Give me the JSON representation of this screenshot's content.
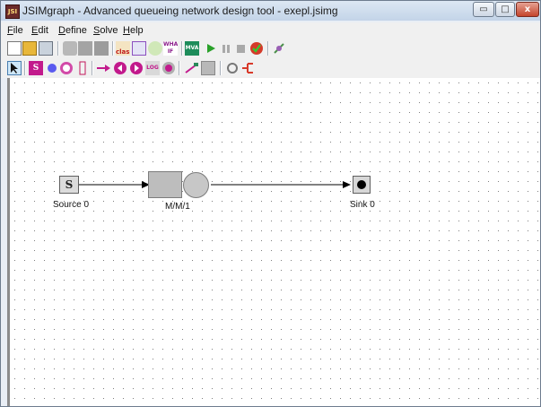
{
  "window": {
    "title": "JSIMgraph - Advanced queueing network design tool - exepl.jsimg",
    "controls": {
      "minimize": "▭",
      "maximize": "□",
      "close": "x"
    }
  },
  "menu": [
    {
      "mnemonic": "F",
      "rest": "ile"
    },
    {
      "mnemonic": "E",
      "rest": "dit"
    },
    {
      "mnemonic": "D",
      "rest": "efine"
    },
    {
      "mnemonic": "S",
      "rest": "olve"
    },
    {
      "mnemonic": "H",
      "rest": "elp"
    }
  ],
  "toolbar_main": {
    "icons": [
      "new-file-icon",
      "open-folder-icon",
      "save-icon",
      "cut-icon",
      "copy-icon",
      "paste-icon",
      "classes-icon",
      "parameters-icon",
      "measures-icon",
      "what-if-icon",
      "mva-icon",
      "run-icon",
      "pause-icon",
      "stop-icon",
      "results-icon",
      "options-icon"
    ],
    "labels": {
      "classes": "class",
      "what_if": "WHAT IF",
      "mva": "MVA"
    }
  },
  "toolbar_components": {
    "icons": [
      "select-arrow-icon",
      "source-icon",
      "sink-icon",
      "queue-station-icon",
      "delay-icon",
      "fork-icon",
      "routing-icon",
      "join-icon",
      "logger-icon",
      "place-icon",
      "connection-icon",
      "blocking-region-icon",
      "refresh-icon",
      "split-icon"
    ],
    "labels": {
      "logger": "LOG"
    }
  },
  "canvas": {
    "nodes": {
      "source": {
        "symbol": "S",
        "label": "Source 0"
      },
      "queue": {
        "label": "M/M/1"
      },
      "sink": {
        "label": "Sink 0"
      }
    }
  }
}
